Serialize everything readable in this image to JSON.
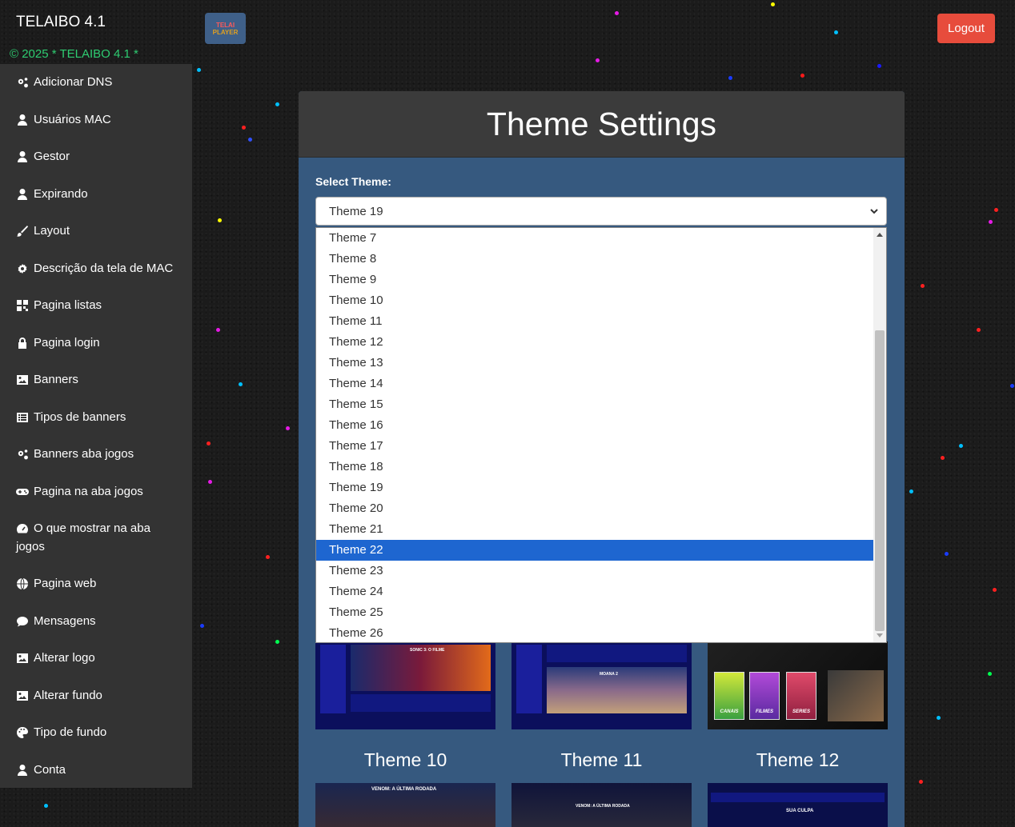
{
  "header": {
    "brand": "TELAIBO 4.1",
    "logo_text_1": "TELAI",
    "logo_text_2": "PLAYER",
    "logout_label": "Logout",
    "copyright": "© 2025 * TELAIBO 4.1 *"
  },
  "sidebar": {
    "items": [
      {
        "label": "Adicionar DNS",
        "icon": "cogs-icon"
      },
      {
        "label": "Usuários MAC",
        "icon": "user-icon"
      },
      {
        "label": "Gestor",
        "icon": "user-icon"
      },
      {
        "label": "Expirando",
        "icon": "user-icon"
      },
      {
        "label": "Layout",
        "icon": "brush-icon"
      },
      {
        "label": "Descrição da tela de MAC",
        "icon": "gear-icon"
      },
      {
        "label": "Pagina listas",
        "icon": "qrcode-icon"
      },
      {
        "label": "Pagina login",
        "icon": "lock-icon"
      },
      {
        "label": "Banners",
        "icon": "image-icon"
      },
      {
        "label": "Tipos de banners",
        "icon": "list-icon"
      },
      {
        "label": "Banners aba jogos",
        "icon": "cogs-icon"
      },
      {
        "label": "Pagina na aba jogos",
        "icon": "gamepad-icon"
      },
      {
        "label": "O que mostrar na aba jogos",
        "icon": "gauge-icon"
      },
      {
        "label": "Pagina web",
        "icon": "globe-icon"
      },
      {
        "label": "Mensagens",
        "icon": "comment-icon"
      },
      {
        "label": "Alterar logo",
        "icon": "image-icon"
      },
      {
        "label": "Alterar fundo",
        "icon": "image-icon"
      },
      {
        "label": "Tipo de fundo",
        "icon": "palette-icon"
      },
      {
        "label": "Conta",
        "icon": "user-icon"
      }
    ]
  },
  "main": {
    "title": "Theme Settings",
    "select_label": "Select Theme:",
    "selected_value": "Theme 19",
    "dropdown_options": [
      "Theme 7",
      "Theme 8",
      "Theme 9",
      "Theme 10",
      "Theme 11",
      "Theme 12",
      "Theme 13",
      "Theme 14",
      "Theme 15",
      "Theme 16",
      "Theme 17",
      "Theme 18",
      "Theme 19",
      "Theme 20",
      "Theme 21",
      "Theme 22",
      "Theme 23",
      "Theme 24",
      "Theme 25",
      "Theme 26"
    ],
    "highlighted_option": "Theme 22",
    "preview_captions": [
      "Theme 10",
      "Theme 11",
      "Theme 12"
    ],
    "preview_texts": {
      "t7_title": "SONIC 3: O FILME",
      "t8_title": "MOANA 2",
      "t9_cards": [
        "CANAIS",
        "FILMES",
        "SERIES"
      ],
      "t10_title": "VENOM: A ÚLTIMA RODADA",
      "t11_title": "VENOM: A ÚLTIMA RODADA",
      "t12_title": "SUA CULPA"
    }
  },
  "colors": {
    "sidebar_bg": "#333333",
    "panel_bg": "#36597f",
    "panel_head_bg": "#3b3b3b",
    "logout_bg": "#e74c3c",
    "copyright": "#2ecc71",
    "highlight": "#1e66d0"
  }
}
